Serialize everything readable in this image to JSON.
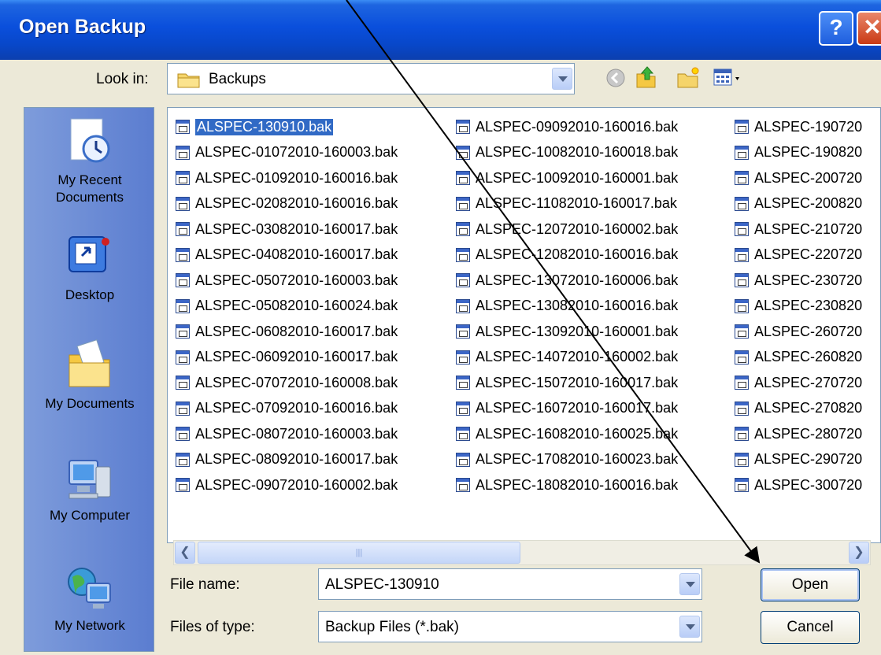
{
  "window": {
    "title": "Open Backup"
  },
  "toolbar": {
    "look_in_label": "Look in:",
    "look_in_value": "Backups"
  },
  "places": [
    {
      "label": "My Recent Documents",
      "icon": "recent-documents-icon"
    },
    {
      "label": "Desktop",
      "icon": "desktop-icon"
    },
    {
      "label": "My Documents",
      "icon": "my-documents-icon"
    },
    {
      "label": "My Computer",
      "icon": "my-computer-icon"
    },
    {
      "label": "My Network",
      "icon": "my-network-icon"
    }
  ],
  "files": {
    "columns": [
      [
        "ALSPEC-130910.bak",
        "ALSPEC-01072010-160003.bak",
        "ALSPEC-01092010-160016.bak",
        "ALSPEC-02082010-160016.bak",
        "ALSPEC-03082010-160017.bak",
        "ALSPEC-04082010-160017.bak",
        "ALSPEC-05072010-160003.bak",
        "ALSPEC-05082010-160024.bak",
        "ALSPEC-06082010-160017.bak",
        "ALSPEC-06092010-160017.bak",
        "ALSPEC-07072010-160008.bak",
        "ALSPEC-07092010-160016.bak",
        "ALSPEC-08072010-160003.bak",
        "ALSPEC-08092010-160017.bak",
        "ALSPEC-09072010-160002.bak"
      ],
      [
        "ALSPEC-09092010-160016.bak",
        "ALSPEC-10082010-160018.bak",
        "ALSPEC-10092010-160001.bak",
        "ALSPEC-11082010-160017.bak",
        "ALSPEC-12072010-160002.bak",
        "ALSPEC-12082010-160016.bak",
        "ALSPEC-13072010-160006.bak",
        "ALSPEC-13082010-160016.bak",
        "ALSPEC-13092010-160001.bak",
        "ALSPEC-14072010-160002.bak",
        "ALSPEC-15072010-160017.bak",
        "ALSPEC-16072010-160017.bak",
        "ALSPEC-16082010-160025.bak",
        "ALSPEC-17082010-160023.bak",
        "ALSPEC-18082010-160016.bak"
      ],
      [
        "ALSPEC-190720",
        "ALSPEC-190820",
        "ALSPEC-200720",
        "ALSPEC-200820",
        "ALSPEC-210720",
        "ALSPEC-220720",
        "ALSPEC-230720",
        "ALSPEC-230820",
        "ALSPEC-260720",
        "ALSPEC-260820",
        "ALSPEC-270720",
        "ALSPEC-270820",
        "ALSPEC-280720",
        "ALSPEC-290720",
        "ALSPEC-300720"
      ]
    ],
    "selected": "ALSPEC-130910.bak"
  },
  "form": {
    "file_name_label": "File name:",
    "file_name_value": "ALSPEC-130910",
    "file_type_label": "Files of type:",
    "file_type_value": "Backup Files (*.bak)"
  },
  "buttons": {
    "open": "Open",
    "cancel": "Cancel"
  },
  "colors": {
    "title_bar": "#0a4fdc",
    "selection": "#316ac5",
    "dialog": "#ece9d8"
  }
}
